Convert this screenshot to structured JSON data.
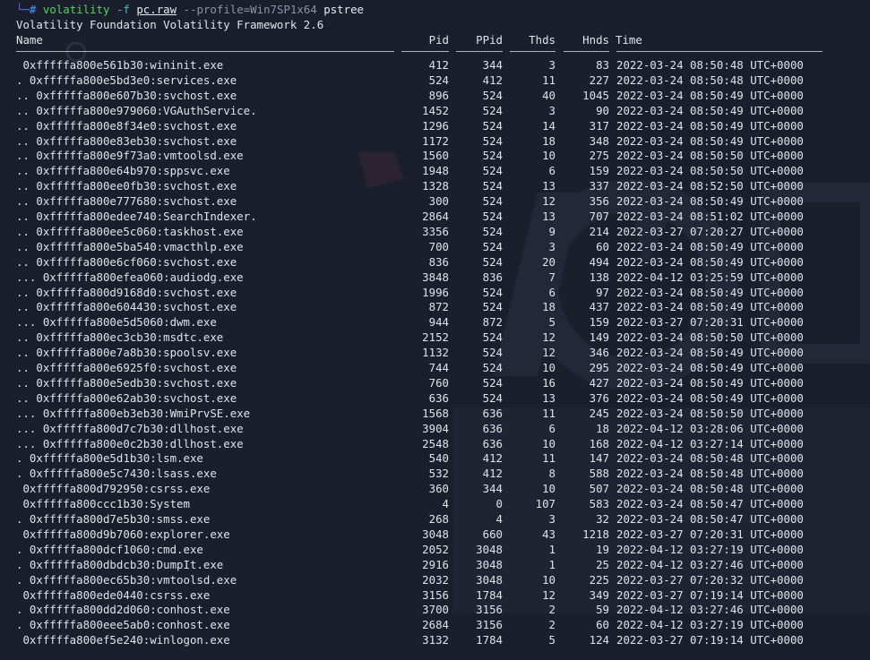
{
  "terminal": {
    "prompt_corner": "└─",
    "prompt_symbol": "#",
    "command": {
      "name": "volatility",
      "flag_file": "-f",
      "file": "pc.raw",
      "profile": "--profile=Win7SP1x64",
      "plugin": "pstree"
    },
    "banner": "Volatility Foundation Volatility Framework 2.6",
    "headers": {
      "name": "Name",
      "pid": "Pid",
      "ppid": "PPid",
      "thds": "Thds",
      "hnds": "Hnds",
      "time": "Time"
    },
    "rows": [
      {
        "name": " 0xfffffa800e561b30:wininit.exe",
        "pid": "412",
        "ppid": "344",
        "thds": "3",
        "hnds": "83",
        "time": "2022-03-24 08:50:48 UTC+0000"
      },
      {
        "name": ". 0xfffffa800e5bd3e0:services.exe",
        "pid": "524",
        "ppid": "412",
        "thds": "11",
        "hnds": "227",
        "time": "2022-03-24 08:50:48 UTC+0000"
      },
      {
        "name": ".. 0xfffffa800e607b30:svchost.exe",
        "pid": "896",
        "ppid": "524",
        "thds": "40",
        "hnds": "1045",
        "time": "2022-03-24 08:50:49 UTC+0000"
      },
      {
        "name": ".. 0xfffffa800e979060:VGAuthService.",
        "pid": "1452",
        "ppid": "524",
        "thds": "3",
        "hnds": "90",
        "time": "2022-03-24 08:50:49 UTC+0000"
      },
      {
        "name": ".. 0xfffffa800e8f34e0:svchost.exe",
        "pid": "1296",
        "ppid": "524",
        "thds": "14",
        "hnds": "317",
        "time": "2022-03-24 08:50:49 UTC+0000"
      },
      {
        "name": ".. 0xfffffa800e83eb30:svchost.exe",
        "pid": "1172",
        "ppid": "524",
        "thds": "18",
        "hnds": "348",
        "time": "2022-03-24 08:50:49 UTC+0000"
      },
      {
        "name": ".. 0xfffffa800e9f73a0:vmtoolsd.exe",
        "pid": "1560",
        "ppid": "524",
        "thds": "10",
        "hnds": "275",
        "time": "2022-03-24 08:50:50 UTC+0000"
      },
      {
        "name": ".. 0xfffffa800e64b970:sppsvc.exe",
        "pid": "1948",
        "ppid": "524",
        "thds": "6",
        "hnds": "159",
        "time": "2022-03-24 08:50:50 UTC+0000"
      },
      {
        "name": ".. 0xfffffa800ee0fb30:svchost.exe",
        "pid": "1328",
        "ppid": "524",
        "thds": "13",
        "hnds": "337",
        "time": "2022-03-24 08:52:50 UTC+0000"
      },
      {
        "name": ".. 0xfffffa800e777680:svchost.exe",
        "pid": "300",
        "ppid": "524",
        "thds": "12",
        "hnds": "356",
        "time": "2022-03-24 08:50:49 UTC+0000"
      },
      {
        "name": ".. 0xfffffa800edee740:SearchIndexer.",
        "pid": "2864",
        "ppid": "524",
        "thds": "13",
        "hnds": "707",
        "time": "2022-03-24 08:51:02 UTC+0000"
      },
      {
        "name": ".. 0xfffffa800ee5c060:taskhost.exe",
        "pid": "3356",
        "ppid": "524",
        "thds": "9",
        "hnds": "214",
        "time": "2022-03-27 07:20:27 UTC+0000"
      },
      {
        "name": ".. 0xfffffa800e5ba540:vmacthlp.exe",
        "pid": "700",
        "ppid": "524",
        "thds": "3",
        "hnds": "60",
        "time": "2022-03-24 08:50:49 UTC+0000"
      },
      {
        "name": ".. 0xfffffa800e6cf060:svchost.exe",
        "pid": "836",
        "ppid": "524",
        "thds": "20",
        "hnds": "494",
        "time": "2022-03-24 08:50:49 UTC+0000"
      },
      {
        "name": "... 0xfffffa800efea060:audiodg.exe",
        "pid": "3848",
        "ppid": "836",
        "thds": "7",
        "hnds": "138",
        "time": "2022-04-12 03:25:59 UTC+0000"
      },
      {
        "name": ".. 0xfffffa800d9168d0:svchost.exe",
        "pid": "1996",
        "ppid": "524",
        "thds": "6",
        "hnds": "97",
        "time": "2022-03-24 08:50:49 UTC+0000"
      },
      {
        "name": ".. 0xfffffa800e604430:svchost.exe",
        "pid": "872",
        "ppid": "524",
        "thds": "18",
        "hnds": "437",
        "time": "2022-03-24 08:50:49 UTC+0000"
      },
      {
        "name": "... 0xfffffa800e5d5060:dwm.exe",
        "pid": "944",
        "ppid": "872",
        "thds": "5",
        "hnds": "159",
        "time": "2022-03-27 07:20:31 UTC+0000"
      },
      {
        "name": ".. 0xfffffa800ec3cb30:msdtc.exe",
        "pid": "2152",
        "ppid": "524",
        "thds": "12",
        "hnds": "149",
        "time": "2022-03-24 08:50:50 UTC+0000"
      },
      {
        "name": ".. 0xfffffa800e7a8b30:spoolsv.exe",
        "pid": "1132",
        "ppid": "524",
        "thds": "12",
        "hnds": "346",
        "time": "2022-03-24 08:50:49 UTC+0000"
      },
      {
        "name": ".. 0xfffffa800e6925f0:svchost.exe",
        "pid": "744",
        "ppid": "524",
        "thds": "10",
        "hnds": "295",
        "time": "2022-03-24 08:50:49 UTC+0000"
      },
      {
        "name": ".. 0xfffffa800e5edb30:svchost.exe",
        "pid": "760",
        "ppid": "524",
        "thds": "16",
        "hnds": "427",
        "time": "2022-03-24 08:50:49 UTC+0000"
      },
      {
        "name": ".. 0xfffffa800e62ab30:svchost.exe",
        "pid": "636",
        "ppid": "524",
        "thds": "13",
        "hnds": "376",
        "time": "2022-03-24 08:50:49 UTC+0000"
      },
      {
        "name": "... 0xfffffa800eb3eb30:WmiPrvSE.exe",
        "pid": "1568",
        "ppid": "636",
        "thds": "11",
        "hnds": "245",
        "time": "2022-03-24 08:50:50 UTC+0000"
      },
      {
        "name": "... 0xfffffa800d7c7b30:dllhost.exe",
        "pid": "3904",
        "ppid": "636",
        "thds": "6",
        "hnds": "18",
        "time": "2022-04-12 03:28:06 UTC+0000"
      },
      {
        "name": "... 0xfffffa800e0c2b30:dllhost.exe",
        "pid": "2548",
        "ppid": "636",
        "thds": "10",
        "hnds": "168",
        "time": "2022-04-12 03:27:14 UTC+0000"
      },
      {
        "name": ". 0xfffffa800e5d1b30:lsm.exe",
        "pid": "540",
        "ppid": "412",
        "thds": "11",
        "hnds": "147",
        "time": "2022-03-24 08:50:48 UTC+0000"
      },
      {
        "name": ". 0xfffffa800e5c7430:lsass.exe",
        "pid": "532",
        "ppid": "412",
        "thds": "8",
        "hnds": "588",
        "time": "2022-03-24 08:50:48 UTC+0000"
      },
      {
        "name": " 0xfffffa800d792950:csrss.exe",
        "pid": "360",
        "ppid": "344",
        "thds": "10",
        "hnds": "507",
        "time": "2022-03-24 08:50:48 UTC+0000"
      },
      {
        "name": " 0xfffffa800ccc1b30:System",
        "pid": "4",
        "ppid": "0",
        "thds": "107",
        "hnds": "583",
        "time": "2022-03-24 08:50:47 UTC+0000"
      },
      {
        "name": ". 0xfffffa800d7e5b30:smss.exe",
        "pid": "268",
        "ppid": "4",
        "thds": "3",
        "hnds": "32",
        "time": "2022-03-24 08:50:47 UTC+0000"
      },
      {
        "name": " 0xfffffa800d9b7060:explorer.exe",
        "pid": "3048",
        "ppid": "660",
        "thds": "43",
        "hnds": "1218",
        "time": "2022-03-27 07:20:31 UTC+0000"
      },
      {
        "name": ". 0xfffffa800dcf1060:cmd.exe",
        "pid": "2052",
        "ppid": "3048",
        "thds": "1",
        "hnds": "19",
        "time": "2022-04-12 03:27:19 UTC+0000"
      },
      {
        "name": ". 0xfffffa800dbdcb30:DumpIt.exe",
        "pid": "2916",
        "ppid": "3048",
        "thds": "1",
        "hnds": "25",
        "time": "2022-04-12 03:27:46 UTC+0000"
      },
      {
        "name": ". 0xfffffa800ec65b30:vmtoolsd.exe",
        "pid": "2032",
        "ppid": "3048",
        "thds": "10",
        "hnds": "225",
        "time": "2022-03-27 07:20:32 UTC+0000"
      },
      {
        "name": " 0xfffffa800ede0440:csrss.exe",
        "pid": "3156",
        "ppid": "1784",
        "thds": "12",
        "hnds": "349",
        "time": "2022-03-27 07:19:14 UTC+0000"
      },
      {
        "name": ". 0xfffffa800dd2d060:conhost.exe",
        "pid": "3700",
        "ppid": "3156",
        "thds": "2",
        "hnds": "59",
        "time": "2022-04-12 03:27:46 UTC+0000"
      },
      {
        "name": ". 0xfffffa800eee5ab0:conhost.exe",
        "pid": "2684",
        "ppid": "3156",
        "thds": "2",
        "hnds": "60",
        "time": "2022-04-12 03:27:19 UTC+0000"
      },
      {
        "name": " 0xfffffa800ef5e240:winlogon.exe",
        "pid": "3132",
        "ppid": "1784",
        "thds": "5",
        "hnds": "124",
        "time": "2022-03-27 07:19:14 UTC+0000"
      }
    ]
  },
  "colors": {
    "background": "#1b1f2c",
    "text": "#dfe3ea",
    "prompt": "#3d7be0",
    "command": "#4fd65b",
    "flag": "#3fc1c9",
    "profile": "#8b93a5"
  }
}
